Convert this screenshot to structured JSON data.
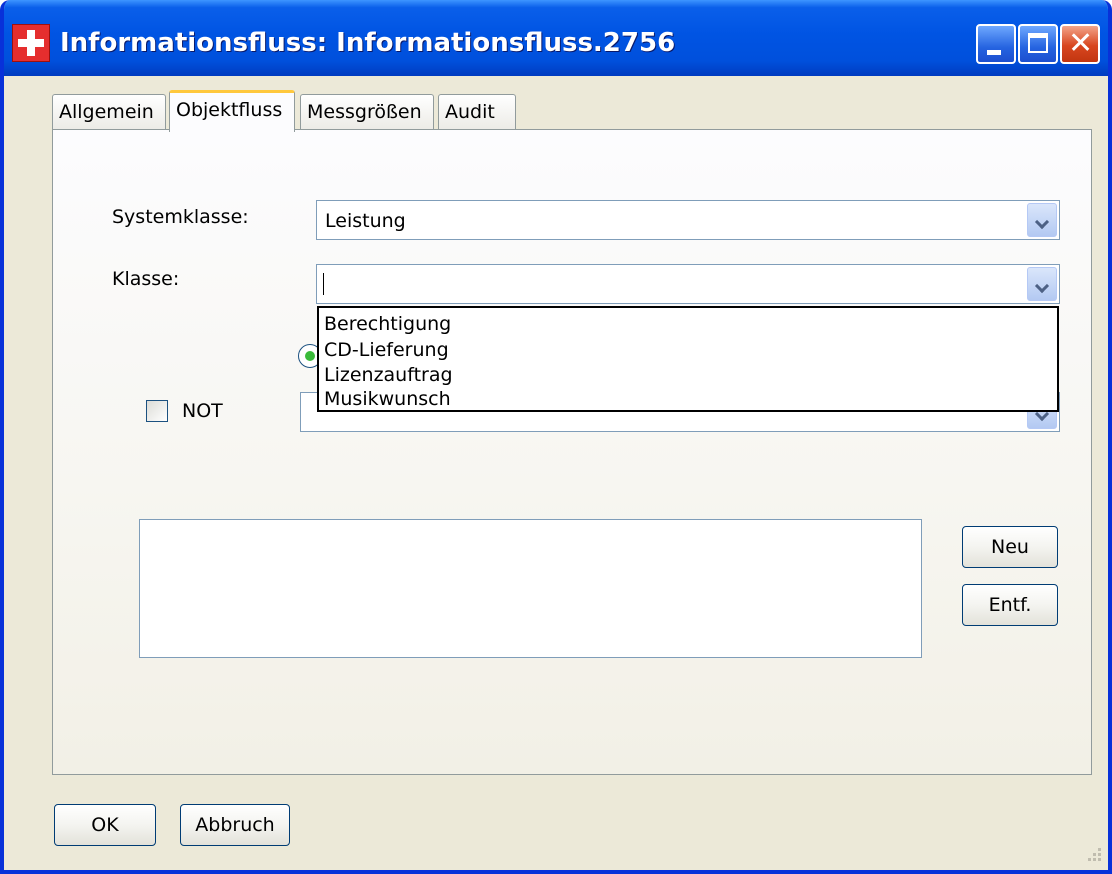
{
  "window": {
    "title": "Informationsfluss: Informationsfluss.2756"
  },
  "tabs": [
    {
      "label": "Allgemein",
      "active": false
    },
    {
      "label": "Objektfluss",
      "active": true
    },
    {
      "label": "Messgrößen",
      "active": false
    },
    {
      "label": "Audit",
      "active": false
    }
  ],
  "form": {
    "systemklasse_label": "Systemklasse:",
    "systemklasse_value": "Leistung",
    "klasse_label": "Klasse:",
    "klasse_value": "",
    "klasse_options": [
      "Berechtigung",
      "CD-Lieferung",
      "Lizenzauftrag",
      "Musikwunsch"
    ],
    "not_label": "NOT",
    "not_checked": false,
    "third_combo_value": ""
  },
  "list_buttons": {
    "new_label": "Neu",
    "remove_label": "Entf."
  },
  "footer": {
    "ok_label": "OK",
    "cancel_label": "Abbruch"
  },
  "colors": {
    "titlebar": "#0054e3",
    "tab_highlight": "#ffc83c",
    "window_bg": "#ece9d8",
    "close_button": "#d8471f"
  }
}
